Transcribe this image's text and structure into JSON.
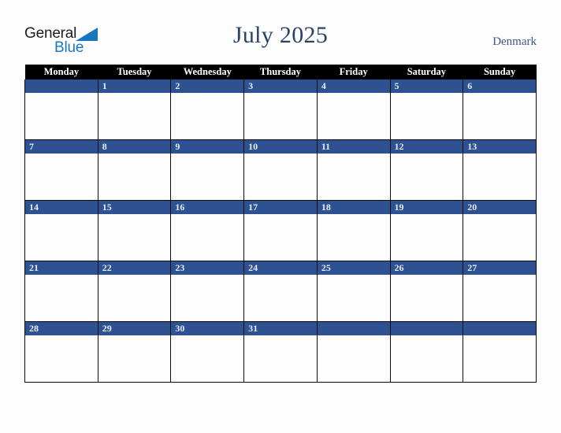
{
  "logo": {
    "word_one": "General",
    "word_two": "Blue",
    "triangle_icon": "triangle-icon",
    "brand_dark": "#1d1d1d",
    "brand_blue": "#1878be"
  },
  "header": {
    "title": "July 2025",
    "country": "Denmark"
  },
  "calendar": {
    "month": "July",
    "year": "2025",
    "accent_blue": "#2d5191",
    "header_background": "#000000",
    "cell_background": "#fdfdfd",
    "weekday_headers": [
      "Monday",
      "Tuesday",
      "Wednesday",
      "Thursday",
      "Friday",
      "Saturday",
      "Sunday"
    ],
    "weeks": [
      [
        "",
        "1",
        "2",
        "3",
        "4",
        "5",
        "6"
      ],
      [
        "7",
        "8",
        "9",
        "10",
        "11",
        "12",
        "13"
      ],
      [
        "14",
        "15",
        "16",
        "17",
        "18",
        "19",
        "20"
      ],
      [
        "21",
        "22",
        "23",
        "24",
        "25",
        "26",
        "27"
      ],
      [
        "28",
        "29",
        "30",
        "31",
        "",
        "",
        ""
      ]
    ]
  }
}
